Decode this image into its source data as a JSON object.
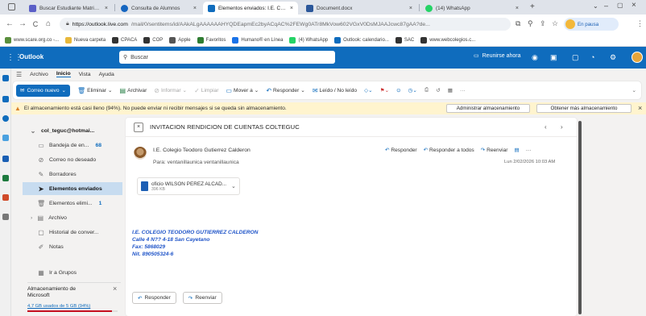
{
  "browser": {
    "tabs": [
      {
        "label": "Buscar Estudiante Matriculad",
        "close": "×",
        "favicon_color": "#5b5fc7",
        "active": false
      },
      {
        "label": "Consulta de Alumnos",
        "close": "×",
        "favicon_color": "#1565c0",
        "active": false
      },
      {
        "label": "Elementos enviados: I.E. Coleg",
        "close": "×",
        "favicon_color": "#0f6cbd",
        "active": true
      },
      {
        "label": "Document.docx",
        "close": "×",
        "favicon_color": "#2b579a",
        "active": false
      },
      {
        "label": "(14) WhatsApp",
        "close": "×",
        "favicon_color": "#25d366",
        "active": false
      }
    ],
    "new_tab": "+",
    "window_controls": [
      "⌄",
      "–",
      "▢",
      "×"
    ],
    "nav": {
      "back": "←",
      "forward": "→",
      "reload": "C",
      "home": "⌂"
    },
    "url_host": "https://outlook.live.com",
    "url_rest": "/mail/0/sentitems/id/AAkALgAAAAAAHYQDEapmEc2byACqAC%2FEWg0ATr8MkVow602VGxV0DsMJAAJcwc87gAA?de...",
    "profile_label": "En pausa",
    "bookmarks": [
      {
        "label": "www.scare.org.co -...",
        "color": "#5a8f3c"
      },
      {
        "label": "Nueva carpeta",
        "color": "#e8b83a"
      },
      {
        "label": "CPACA",
        "color": "#333333"
      },
      {
        "label": "COP",
        "color": "#333333"
      },
      {
        "label": "Apple",
        "color": "#555555"
      },
      {
        "label": "Favoritos",
        "color": "#2f7d32"
      },
      {
        "label": "Humano® en Línea",
        "color": "#1a73e8"
      },
      {
        "label": "(4) WhatsApp",
        "color": "#25d366"
      },
      {
        "label": "Outlook: calendario...",
        "color": "#0f6cbd"
      },
      {
        "label": "SAC",
        "color": "#333333"
      },
      {
        "label": "www.webcolegios.c...",
        "color": "#333333"
      }
    ]
  },
  "outlook": {
    "app_name": "Outlook",
    "search_placeholder": "Buscar",
    "meet_now": "Reunirse ahora",
    "ribbon_tabs": [
      "Archivo",
      "Inicio",
      "Vista",
      "Ayuda"
    ],
    "selected_ribbon_tab": "Inicio",
    "toolbar": {
      "new_mail": "Correo nuevo",
      "delete": "Eliminar",
      "archive": "Archivar",
      "report": "Informar",
      "sweep": "Limpiar",
      "move_to": "Mover a",
      "reply": "Responder",
      "read_unread": "Leído / No leído",
      "more": "···"
    },
    "banner": {
      "message": "El almacenamiento está casi lleno (94%). No puede enviar ni recibir mensajes si se queda sin almacenamiento.",
      "manage_btn": "Administrar almacenamiento",
      "get_more_btn": "Obtener más almacenamiento"
    },
    "folders": {
      "account": "col_teguc@hotmai...",
      "items": [
        {
          "label": "Bandeja de en...",
          "count": "68",
          "icon": "inbox-icon",
          "glyph": "▭"
        },
        {
          "label": "Correo no deseado",
          "count": "",
          "icon": "junk-icon",
          "glyph": "⊘"
        },
        {
          "label": "Borradores",
          "count": "",
          "icon": "drafts-icon",
          "glyph": "✎"
        },
        {
          "label": "Elementos enviados",
          "count": "",
          "icon": "sent-icon",
          "glyph": "➤"
        },
        {
          "label": "Elementos elimi...",
          "count": "1",
          "icon": "trash-icon",
          "glyph": "🗑"
        },
        {
          "label": "Archivo",
          "count": "",
          "icon": "archive-icon",
          "glyph": "▤"
        },
        {
          "label": "Historial de conver...",
          "count": "",
          "icon": "history-icon",
          "glyph": "▢"
        },
        {
          "label": "Notas",
          "count": "",
          "icon": "notes-icon",
          "glyph": "✐"
        }
      ],
      "groups": "Ir a Grupos",
      "storage_title": "Almacenamiento de Microsoft",
      "storage_usage": "4,7 GB usados de 5 GB (94%)",
      "storage_fraction": 0.94
    },
    "message": {
      "subject": "INVITACION RENDICION DE CUENTAS COLTEGUC",
      "sender": "I.E. Colegio Teodoro Gutierrez Calderon",
      "to": "Para: ventanillaunica ventanillaunica",
      "actions": {
        "reply": "Responder",
        "reply_all": "Responder a todos",
        "forward": "Reenviar"
      },
      "date": "Lun 2/02/2026 10:03 AM",
      "attachment": {
        "name": "oficio WILSON PEREZ ALCAD...",
        "size": "396 KB"
      },
      "signature": [
        "I.E. COLEGIO TEODORO GUTIERREZ CALDERON",
        "Calle 4 N?? 4-18 San Cayetano",
        "Fax: 5868029",
        "Nit. 890505324-6"
      ],
      "bottom_reply": "Responder",
      "bottom_forward": "Reenviar"
    }
  },
  "colors": {
    "brand": "#0f6cbd",
    "banner_bg": "#fff4ce",
    "signature": "#1f54c8"
  }
}
